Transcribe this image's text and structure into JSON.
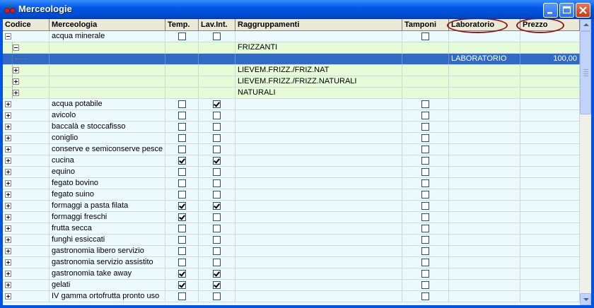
{
  "window": {
    "title": "Merceologie"
  },
  "columns": {
    "codice": "Codice",
    "merceologia": "Merceologia",
    "temp": "Temp.",
    "lav_int": "Lav.Int.",
    "raggruppamenti": "Raggruppamenti",
    "tamponi": "Tamponi",
    "laboratorio": "Laboratorio",
    "prezzo": "Prezzo"
  },
  "rows": [
    {
      "kind": "parent",
      "expanded": true,
      "merceologia": "acqua minerale",
      "temp": false,
      "lav_int": false,
      "tamponi": false,
      "raggruppamento": "",
      "laboratorio": "",
      "prezzo": ""
    },
    {
      "kind": "group",
      "expanded": true,
      "merceologia": "",
      "raggruppamento": "FRIZZANTI",
      "laboratorio": "",
      "prezzo": ""
    },
    {
      "kind": "selected",
      "merceologia": "",
      "raggruppamento": "",
      "laboratorio": "LABORATORIO",
      "prezzo": "100,00"
    },
    {
      "kind": "group",
      "expanded": false,
      "merceologia": "",
      "raggruppamento": "LIEVEM.FRIZZ./FRIZ.NAT",
      "laboratorio": "",
      "prezzo": ""
    },
    {
      "kind": "group",
      "expanded": false,
      "merceologia": "",
      "raggruppamento": "LIEVEM.FRIZZ./FRIZZ.NATURALI",
      "laboratorio": "",
      "prezzo": ""
    },
    {
      "kind": "group",
      "expanded": false,
      "merceologia": "",
      "raggruppamento": "NATURALI",
      "laboratorio": "",
      "prezzo": ""
    },
    {
      "kind": "parent",
      "expanded": false,
      "merceologia": "acqua potabile",
      "temp": false,
      "lav_int": true,
      "tamponi": false
    },
    {
      "kind": "parent",
      "expanded": false,
      "merceologia": "avicolo",
      "temp": false,
      "lav_int": false,
      "tamponi": false
    },
    {
      "kind": "parent",
      "expanded": false,
      "merceologia": "baccalà e stoccafisso",
      "temp": false,
      "lav_int": false,
      "tamponi": false
    },
    {
      "kind": "parent",
      "expanded": false,
      "merceologia": "coniglio",
      "temp": false,
      "lav_int": false,
      "tamponi": false
    },
    {
      "kind": "parent",
      "expanded": false,
      "merceologia": "conserve e semiconserve pesce",
      "temp": false,
      "lav_int": false,
      "tamponi": false
    },
    {
      "kind": "parent",
      "expanded": false,
      "merceologia": "cucina",
      "temp": true,
      "lav_int": true,
      "tamponi": false
    },
    {
      "kind": "parent",
      "expanded": false,
      "merceologia": "equino",
      "temp": false,
      "lav_int": false,
      "tamponi": false
    },
    {
      "kind": "parent",
      "expanded": false,
      "merceologia": "fegato bovino",
      "temp": false,
      "lav_int": false,
      "tamponi": false
    },
    {
      "kind": "parent",
      "expanded": false,
      "merceologia": "fegato suino",
      "temp": false,
      "lav_int": false,
      "tamponi": false
    },
    {
      "kind": "parent",
      "expanded": false,
      "merceologia": "formaggi a pasta filata",
      "temp": true,
      "lav_int": true,
      "tamponi": false
    },
    {
      "kind": "parent",
      "expanded": false,
      "merceologia": "formaggi freschi",
      "temp": true,
      "lav_int": false,
      "tamponi": false
    },
    {
      "kind": "parent",
      "expanded": false,
      "merceologia": "frutta secca",
      "temp": false,
      "lav_int": false,
      "tamponi": false
    },
    {
      "kind": "parent",
      "expanded": false,
      "merceologia": "funghi essiccati",
      "temp": false,
      "lav_int": false,
      "tamponi": false
    },
    {
      "kind": "parent",
      "expanded": false,
      "merceologia": "gastronomia libero servizio",
      "temp": false,
      "lav_int": false,
      "tamponi": false
    },
    {
      "kind": "parent",
      "expanded": false,
      "merceologia": "gastronomia servizio assistito",
      "temp": false,
      "lav_int": false,
      "tamponi": false
    },
    {
      "kind": "parent",
      "expanded": false,
      "merceologia": "gastronomia take away",
      "temp": true,
      "lav_int": true,
      "tamponi": false
    },
    {
      "kind": "parent",
      "expanded": false,
      "merceologia": "gelati",
      "temp": true,
      "lav_int": true,
      "tamponi": false
    },
    {
      "kind": "parent",
      "expanded": false,
      "merceologia": "IV gamma ortofrutta pronto uso",
      "temp": false,
      "lav_int": false,
      "tamponi": false
    }
  ],
  "colors": {
    "grid_bg": "#ecf9ff",
    "group_bg": "#e6fbd8",
    "selection": "#316ac5",
    "annotation_circle": "#8b1a1a"
  },
  "icons": {
    "window_icon": "cherries-icon",
    "minimize": "minimize-icon",
    "maximize": "maximize-icon",
    "close": "close-icon"
  }
}
